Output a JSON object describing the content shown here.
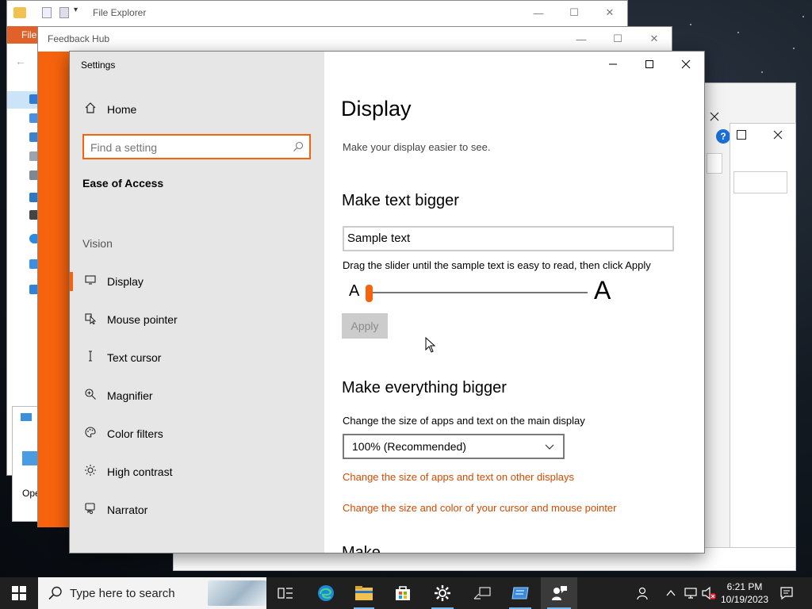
{
  "desktop": {
    "file_explorer": {
      "title": "File Explorer",
      "ribbon_tab": "File",
      "side_fragment": "Ope"
    },
    "feedback_hub": {
      "title": "Feedback Hub"
    }
  },
  "settings": {
    "window_title": "Settings",
    "nav": {
      "home": "Home",
      "search_placeholder": "Find a setting",
      "category": "Ease of Access",
      "group": "Vision",
      "items": [
        {
          "label": "Display",
          "icon": "monitor-icon",
          "selected": true
        },
        {
          "label": "Mouse pointer",
          "icon": "mouse-pointer-icon"
        },
        {
          "label": "Text cursor",
          "icon": "text-cursor-icon"
        },
        {
          "label": "Magnifier",
          "icon": "magnifier-icon"
        },
        {
          "label": "Color filters",
          "icon": "palette-icon"
        },
        {
          "label": "High contrast",
          "icon": "sun-icon"
        },
        {
          "label": "Narrator",
          "icon": "narrator-icon"
        }
      ]
    },
    "main": {
      "title": "Display",
      "subtitle": "Make your display easier to see.",
      "text_bigger": {
        "heading": "Make text bigger",
        "sample_text": "Sample text",
        "hint": "Drag the slider until the sample text is easy to read, then click Apply",
        "small_a": "A",
        "big_a": "A",
        "slider_value_percent": 0,
        "apply_label": "Apply"
      },
      "everything_bigger": {
        "heading": "Make everything bigger",
        "description": "Change the size of apps and text on the main display",
        "selected_scale": "100% (Recommended)",
        "link_other_displays": "Change the size of apps and text on other displays",
        "link_cursor": "Change the size and color of your cursor and mouse pointer"
      },
      "cut_off_heading": "Make ...... ..... ... ......"
    }
  },
  "taskbar": {
    "search_placeholder": "Type here to search",
    "time": "6:21 PM",
    "date": "10/19/2023",
    "accent_color": "#f7630c"
  }
}
